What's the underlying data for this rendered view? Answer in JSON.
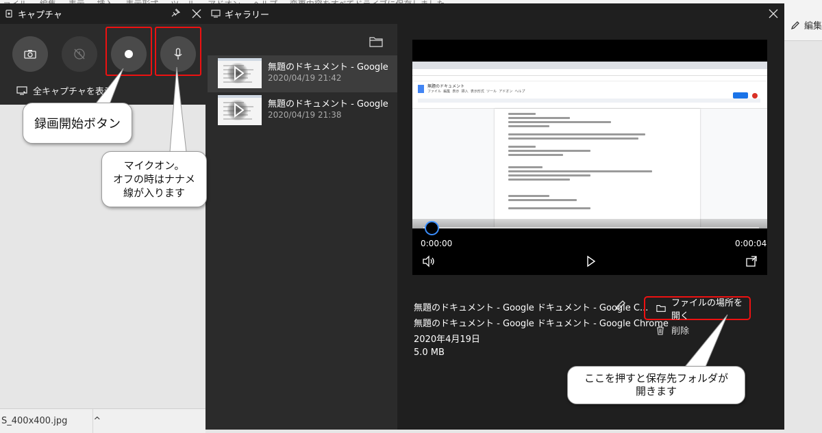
{
  "background": {
    "menu_items": [
      "ァイル",
      "編集",
      "表示",
      "挿入",
      "表示形式",
      "ツール",
      "アドオン",
      "ヘルプ",
      "変更内容をすべてドライブに保存しました"
    ],
    "toolbar_edit_label": "編集",
    "download_file": "S_400x400.jpg",
    "download_chevron": "^"
  },
  "capture": {
    "title": "キャプチャ",
    "show_all_label": "全キャプチャを表示"
  },
  "gallery": {
    "title": "ギャラリー",
    "items": [
      {
        "name": "無題のドキュメント - Google ドキュメント - Google Chrome",
        "date": "2020/04/19 21:42"
      },
      {
        "name": "無題のドキュメント - Google ドキュメント - Google Chrome",
        "date": "2020/04/19 21:38"
      }
    ],
    "player": {
      "time_current": "0:00:00",
      "time_total": "0:00:04",
      "progress": 0.0
    },
    "details": {
      "file_name": "無題のドキュメント - Google ドキュメント - Google C...",
      "window_title": "無題のドキュメント - Google ドキュメント - Google Chrome",
      "date": "2020年4月19日",
      "size": "5.0 MB"
    },
    "open_location_label": "ファイルの場所を開く",
    "delete_label": "削除"
  },
  "recorded_doc": {
    "doc_title": "無題のドキュメント",
    "menu_items": [
      "ファイル",
      "編集",
      "表示",
      "挿入",
      "表示形式",
      "ツール",
      "アドオン",
      "ヘルプ"
    ]
  },
  "annotations": {
    "record_button_callout": "録画開始ボタン",
    "mic_callout_line1": "マイクオン。",
    "mic_callout_line2": "オフの時はナナメ",
    "mic_callout_line3": "線が入ります",
    "folder_callout_line1": "ここを押すと保存先フォルダが",
    "folder_callout_line2": "開きます"
  },
  "colors": {
    "highlight_red": "#ee1111",
    "knob_blue": "#3b8fff",
    "gallery_bg": "#1f1f1f",
    "list_bg": "#2b2b2b"
  }
}
